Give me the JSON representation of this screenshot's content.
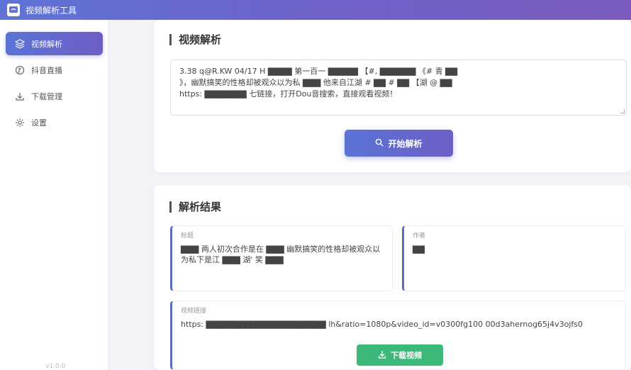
{
  "app": {
    "title": "视频解析工具",
    "version": "v1.0.0"
  },
  "sidebar": {
    "items": [
      {
        "label": "视频解析",
        "icon": "layers-icon",
        "active": true
      },
      {
        "label": "抖音直播",
        "icon": "live-icon",
        "active": false
      },
      {
        "label": "下载管理",
        "icon": "download-icon",
        "active": false
      },
      {
        "label": "设置",
        "icon": "gear-icon",
        "active": false
      }
    ]
  },
  "parse_section": {
    "title": "视频解析",
    "input_value_line1": "3.38 q@R.KW 04/17 H ▇▇▇▇ 第一百一 ▇▇▇▇▇ 【#, ▇▇▇▇▇▇ 《# 青 ▇▇",
    "input_value_line2": "》，幽默搞笑的性格却被观众以为私 ▇▇▇ 他来自江湖 # ▇▇ # ▇▇ 【湖 @ ▇▇",
    "input_value_line3": "https: ▇▇▇▇▇▇▇ 七链接，打开Dou音搜索，直接观看视频！",
    "button_label": "开始解析"
  },
  "result_section": {
    "title": "解析结果",
    "title_field_label": "标题",
    "title_field_value": "▇▇▇ 两人初次合作是在 ▇▇▇ 幽默搞笑的性格却被观众以为私下是江 ▇▇▇ 湖' 笑 ▇▇▇",
    "author_field_label": "作者",
    "author_field_value": "▇▇",
    "link_field_label": "视频链接",
    "link_field_value": "https: ▇▇▇▇▇▇▇▇▇▇▇▇▇▇▇▇▇▇▇▇ lh&ratio=1080p&video_id=v0300fg100 00d3ahernog65j4v3ojfs0",
    "download_button_label": "下载视频"
  },
  "colors": {
    "accent": "#5f6fd4",
    "success": "#3cb878"
  }
}
